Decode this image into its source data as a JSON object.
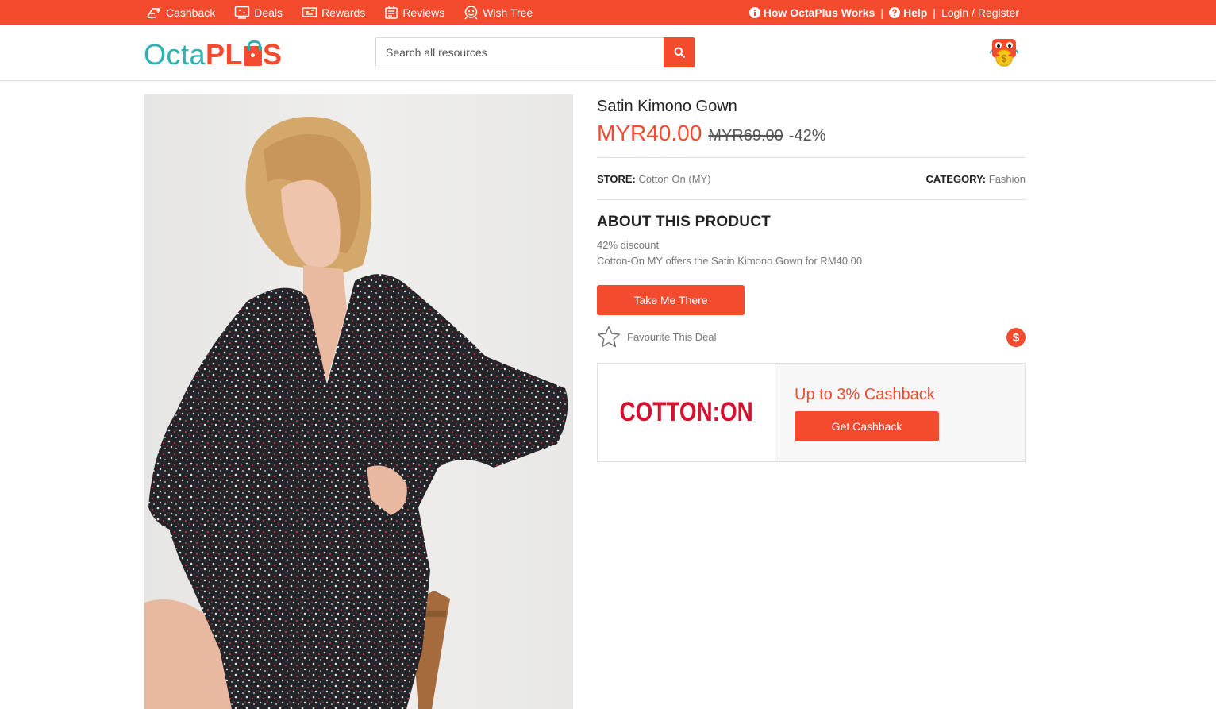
{
  "topbar": {
    "nav": [
      {
        "label": "Cashback",
        "icon": "cashback-icon"
      },
      {
        "label": "Deals",
        "icon": "deals-icon"
      },
      {
        "label": "Rewards",
        "icon": "rewards-icon"
      },
      {
        "label": "Reviews",
        "icon": "reviews-icon"
      },
      {
        "label": "Wish Tree",
        "icon": "wish-tree-icon"
      }
    ],
    "how_it_works": "How OctaPlus Works",
    "help": "Help",
    "separator": "|",
    "login": "Login / Register"
  },
  "header": {
    "logo_octa": "Octa",
    "logo_pl": "PL",
    "logo_s": "S",
    "search_placeholder": "Search all resources"
  },
  "product": {
    "title": "Satin Kimono Gown",
    "price_now": "MYR40.00",
    "price_old": "MYR69.00",
    "discount": "-42%",
    "store_label": "STORE:",
    "store_value": "Cotton On (MY)",
    "category_label": "CATEGORY:",
    "category_value": "Fashion",
    "about_heading": "ABOUT THIS PRODUCT",
    "about_line1": "42% discount",
    "about_line2": "Cotton-On MY offers the Satin Kimono Gown for RM40.00",
    "cta_label": "Take Me There",
    "favourite_label": "Favourite This Deal",
    "dollar_symbol": "$"
  },
  "cashback": {
    "store_logo_text": "COTTON:ON",
    "title": "Up to 3% Cashback",
    "button_label": "Get Cashback"
  },
  "colors": {
    "brand": "#f44a2e",
    "logo_teal": "#2ab3b2",
    "cotton_on_red": "#d6112f"
  }
}
